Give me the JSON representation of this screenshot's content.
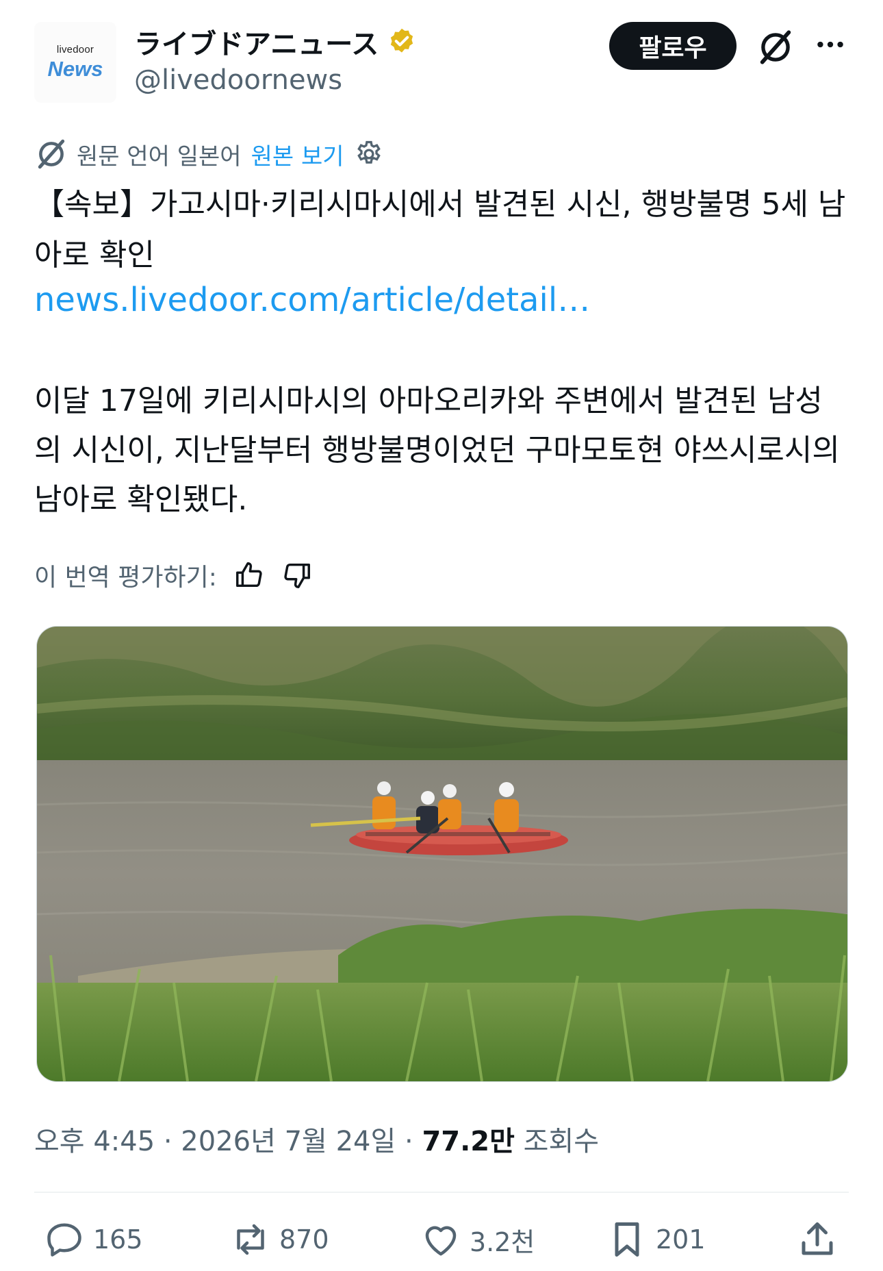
{
  "account": {
    "avatar_small": "livedoor",
    "avatar_big": "News",
    "display_name": "ライブドアニュース",
    "handle": "@livedoornews",
    "follow_label": "팔로우"
  },
  "translation": {
    "source_text": "원문 언어 일본어",
    "view_original": "원본 보기"
  },
  "post": {
    "title": "【속보】가고시마·키리시마시에서 발견된 시신, 행방불명 5세 남아로 확인",
    "link": "news.livedoor.com/article/detail…",
    "body": "이달 17일에 키리시마시의 아마오리카와 주변에서 발견된 남성의 시신이, 지난달부터 행방불명이었던 구마모토현 야쓰시로시의 남아로 확인됐다."
  },
  "rating": {
    "label": "이 번역 평가하기:"
  },
  "meta": {
    "time": "오후 4:45",
    "sep1": " · ",
    "date": "2026년 7월 24일",
    "sep2": " · ",
    "views": "77.2만",
    "views_label": " 조회수"
  },
  "actions": {
    "replies": "165",
    "reposts": "870",
    "likes": "3.2천",
    "bookmarks": "201"
  },
  "colors": {
    "accent": "#1d9bf0",
    "text": "#0f1419",
    "muted": "#536471",
    "verified": "#e2b719"
  },
  "icons": [
    "verified-badge-icon",
    "grok-icon",
    "more-icon",
    "translate-icon",
    "settings-gear-icon",
    "thumbs-up-icon",
    "thumbs-down-icon",
    "reply-icon",
    "repost-icon",
    "like-icon",
    "bookmark-icon",
    "share-icon"
  ]
}
